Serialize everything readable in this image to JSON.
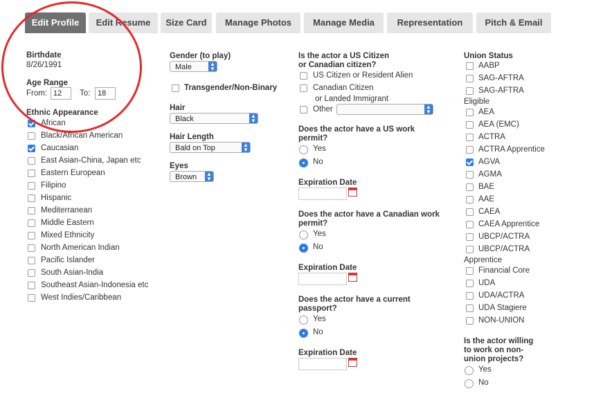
{
  "tabs": [
    "Edit Profile",
    "Edit Resume",
    "Size Card",
    "Manage Photos",
    "Manage Media",
    "Representation",
    "Pitch & Email"
  ],
  "birthdate": {
    "label": "Birthdate",
    "value": "8/26/1991"
  },
  "age_range": {
    "label": "Age Range",
    "from_label": "From:",
    "from_value": "12",
    "to_label": "To:",
    "to_value": "18"
  },
  "ethnic": {
    "label": "Ethnic Appearance",
    "items": [
      {
        "label": "African",
        "checked": true
      },
      {
        "label": "Black/African American",
        "checked": false
      },
      {
        "label": "Caucasian",
        "checked": true
      },
      {
        "label": "East Asian-China, Japan etc",
        "checked": false
      },
      {
        "label": "Eastern European",
        "checked": false
      },
      {
        "label": "Filipino",
        "checked": false
      },
      {
        "label": "Hispanic",
        "checked": false
      },
      {
        "label": "Mediterranean",
        "checked": false
      },
      {
        "label": "Middle Eastern",
        "checked": false
      },
      {
        "label": "Mixed Ethnicity",
        "checked": false
      },
      {
        "label": "North American Indian",
        "checked": false
      },
      {
        "label": "Pacific Islander",
        "checked": false
      },
      {
        "label": "South Asian-India",
        "checked": false
      },
      {
        "label": "Southeast Asian-Indonesia etc",
        "checked": false
      },
      {
        "label": "West Indies/Caribbean",
        "checked": false
      }
    ]
  },
  "gender": {
    "label": "Gender (to play)",
    "value": "Male"
  },
  "transgender": {
    "label": "Transgender/Non-Binary",
    "checked": false
  },
  "hair": {
    "label": "Hair",
    "value": "Black"
  },
  "hair_length": {
    "label": "Hair Length",
    "value": "Bald on Top"
  },
  "eyes": {
    "label": "Eyes",
    "value": "Brown"
  },
  "citizen": {
    "label_line1": "Is the actor a US Citizen",
    "label_line2": "or Canadian citizen?",
    "opt1": "US Citizen or Resident Alien",
    "opt2a": "Canadian Citizen",
    "opt2b": "or Landed Immigrant",
    "opt3": "Other",
    "other_value": ""
  },
  "us_permit": {
    "line1": "Does the actor have a US work",
    "line2": "permit?",
    "yes": "Yes",
    "no": "No",
    "selected": "No"
  },
  "exp1": "Expiration Date",
  "ca_permit": {
    "line1": "Does the actor have a Canadian work",
    "line2": "permit?",
    "yes": "Yes",
    "no": "No",
    "selected": "No"
  },
  "exp2": "Expiration Date",
  "passport": {
    "line1": "Does the actor have a current",
    "line2": "passport?",
    "yes": "Yes",
    "no": "No",
    "selected": "No"
  },
  "exp3": "Expiration Date",
  "union": {
    "label": "Union Status",
    "items": [
      {
        "label": "AABP",
        "checked": false
      },
      {
        "label": "SAG-AFTRA",
        "checked": false
      },
      {
        "label": "SAG-AFTRA",
        "checked": false,
        "suffix": "Eligible"
      },
      {
        "label": "AEA",
        "checked": false
      },
      {
        "label": "AEA (EMC)",
        "checked": false
      },
      {
        "label": "ACTRA",
        "checked": false
      },
      {
        "label": "ACTRA Apprentice",
        "checked": false
      },
      {
        "label": "AGVA",
        "checked": true
      },
      {
        "label": "AGMA",
        "checked": false
      },
      {
        "label": "BAE",
        "checked": false
      },
      {
        "label": "AAE",
        "checked": false
      },
      {
        "label": "CAEA",
        "checked": false
      },
      {
        "label": "CAEA Apprentice",
        "checked": false
      },
      {
        "label": "UBCP/ACTRA",
        "checked": false
      },
      {
        "label": "UBCP/ACTRA",
        "checked": false,
        "suffix": "Apprentice"
      },
      {
        "label": "Financial Core",
        "checked": false
      },
      {
        "label": "UDA",
        "checked": false
      },
      {
        "label": "UDA/ACTRA",
        "checked": false
      },
      {
        "label": "UDA Stagiere",
        "checked": false
      },
      {
        "label": "NON-UNION",
        "checked": false
      }
    ]
  },
  "nonunion": {
    "line1": "Is the actor willing",
    "line2": "to work on non-",
    "line3": "union projects?",
    "yes": "Yes",
    "no": "No",
    "selected": ""
  },
  "colors": {
    "accent": "#2c7be5",
    "annotation": "#e22a2a",
    "active_tab": "#707070"
  }
}
